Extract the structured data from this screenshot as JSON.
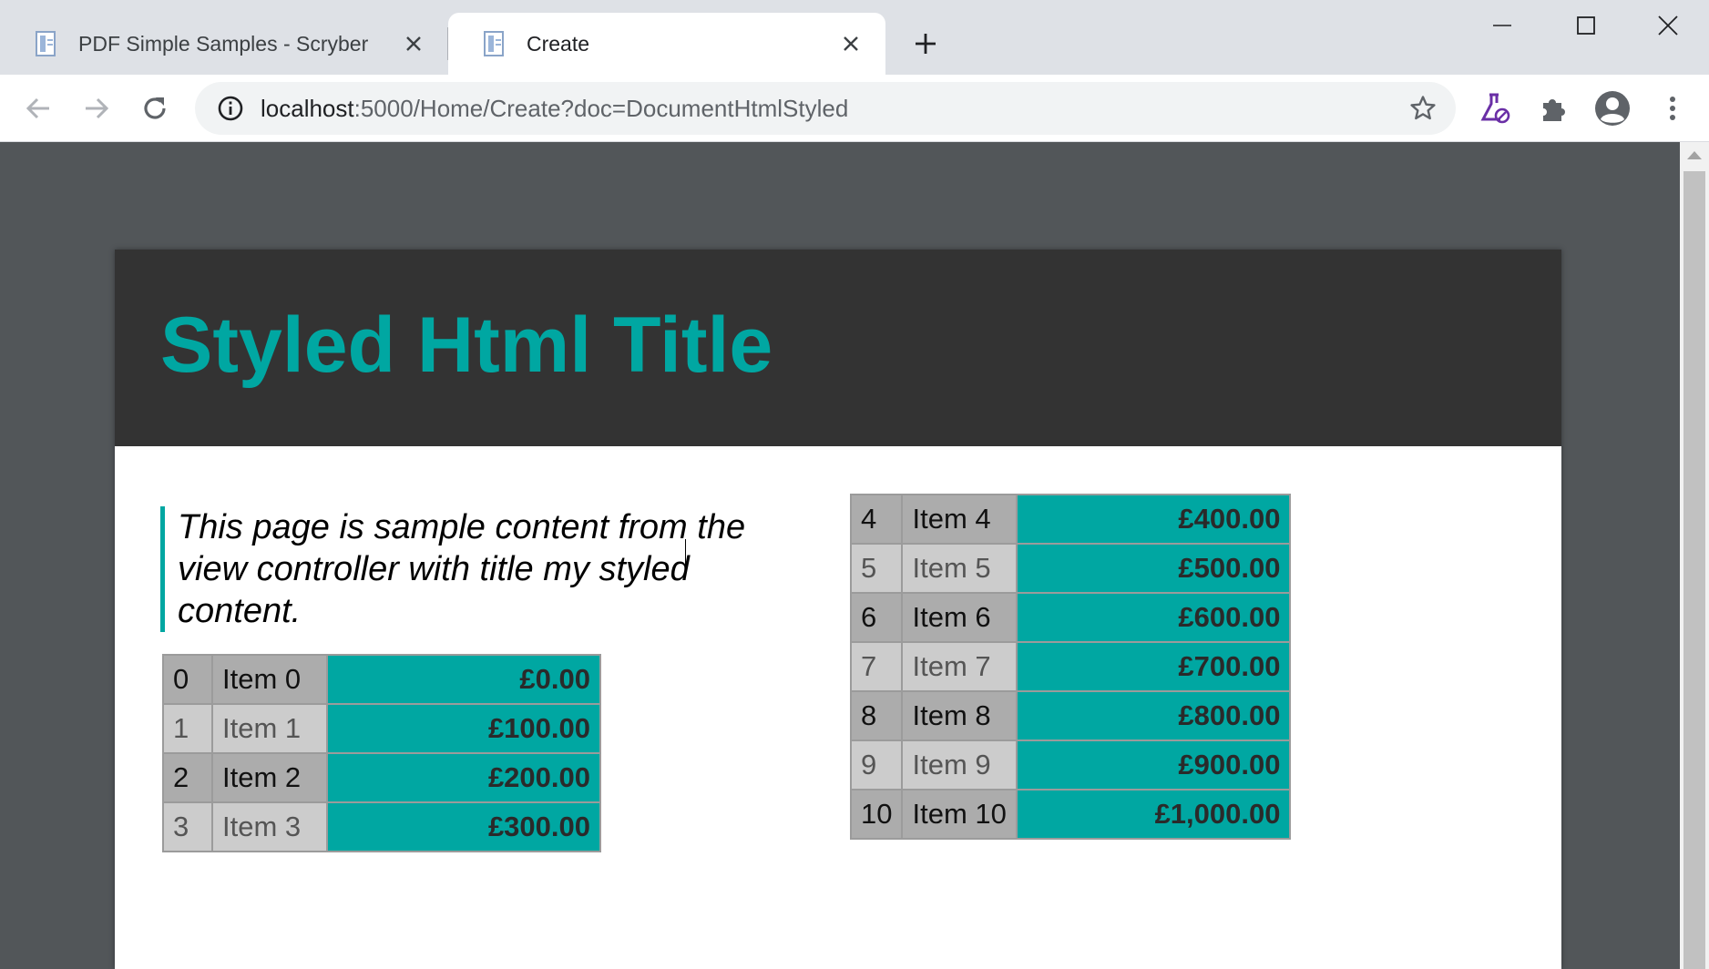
{
  "browser": {
    "tabs": [
      {
        "title": "PDF Simple Samples - Scryber",
        "active": false
      },
      {
        "title": "Create",
        "active": true
      }
    ],
    "url": {
      "host": "localhost",
      "path": ":5000/Home/Create?doc=DocumentHtmlStyled"
    }
  },
  "document": {
    "title": "Styled Html Title",
    "quote": "This page is sample content from the view controller with title my styled content.",
    "table_left": [
      {
        "num": "0",
        "name": "Item 0",
        "price": "£0.00"
      },
      {
        "num": "1",
        "name": "Item 1",
        "price": "£100.00"
      },
      {
        "num": "2",
        "name": "Item 2",
        "price": "£200.00"
      },
      {
        "num": "3",
        "name": "Item 3",
        "price": "£300.00"
      }
    ],
    "table_right": [
      {
        "num": "4",
        "name": "Item 4",
        "price": "£400.00"
      },
      {
        "num": "5",
        "name": "Item 5",
        "price": "£500.00"
      },
      {
        "num": "6",
        "name": "Item 6",
        "price": "£600.00"
      },
      {
        "num": "7",
        "name": "Item 7",
        "price": "£700.00"
      },
      {
        "num": "8",
        "name": "Item 8",
        "price": "£800.00"
      },
      {
        "num": "9",
        "name": "Item 9",
        "price": "£900.00"
      },
      {
        "num": "10",
        "name": "Item 10",
        "price": "£1,000.00"
      }
    ]
  },
  "colors": {
    "accent": "#00a7a2",
    "header_bg": "#333333",
    "row_dark": "#acacac",
    "row_light": "#cccccc"
  },
  "icons": [
    "document-icon",
    "close-icon",
    "plus-icon",
    "minimize-icon",
    "maximize-icon",
    "back-icon",
    "forward-icon",
    "reload-icon",
    "info-icon",
    "star-icon",
    "labs-icon",
    "extensions-icon",
    "profile-icon",
    "menu-icon"
  ]
}
